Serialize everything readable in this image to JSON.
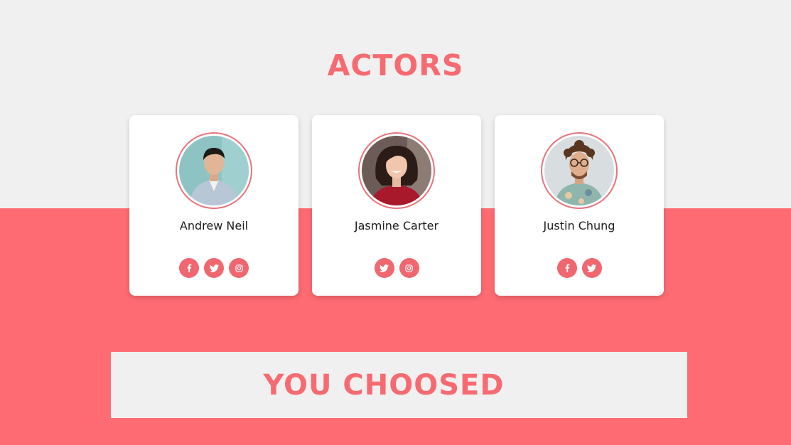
{
  "page": {
    "title": "ACTORS",
    "accent_color": "#f66b71",
    "band_color": "#ff6b73",
    "background_color": "#f1f0f0"
  },
  "actors": [
    {
      "name": "Andrew Neil",
      "photo": "avatar-young-man-denim-shirt",
      "socials": [
        "facebook-icon",
        "twitter-icon",
        "instagram-icon"
      ]
    },
    {
      "name": "Jasmine Carter",
      "photo": "avatar-smiling-woman-red-top",
      "socials": [
        "twitter-icon",
        "instagram-icon"
      ]
    },
    {
      "name": "Justin Chung",
      "photo": "avatar-curly-hair-man-glasses",
      "socials": [
        "facebook-icon",
        "twitter-icon"
      ]
    }
  ],
  "selection": {
    "label": "YOU CHOOSED"
  }
}
